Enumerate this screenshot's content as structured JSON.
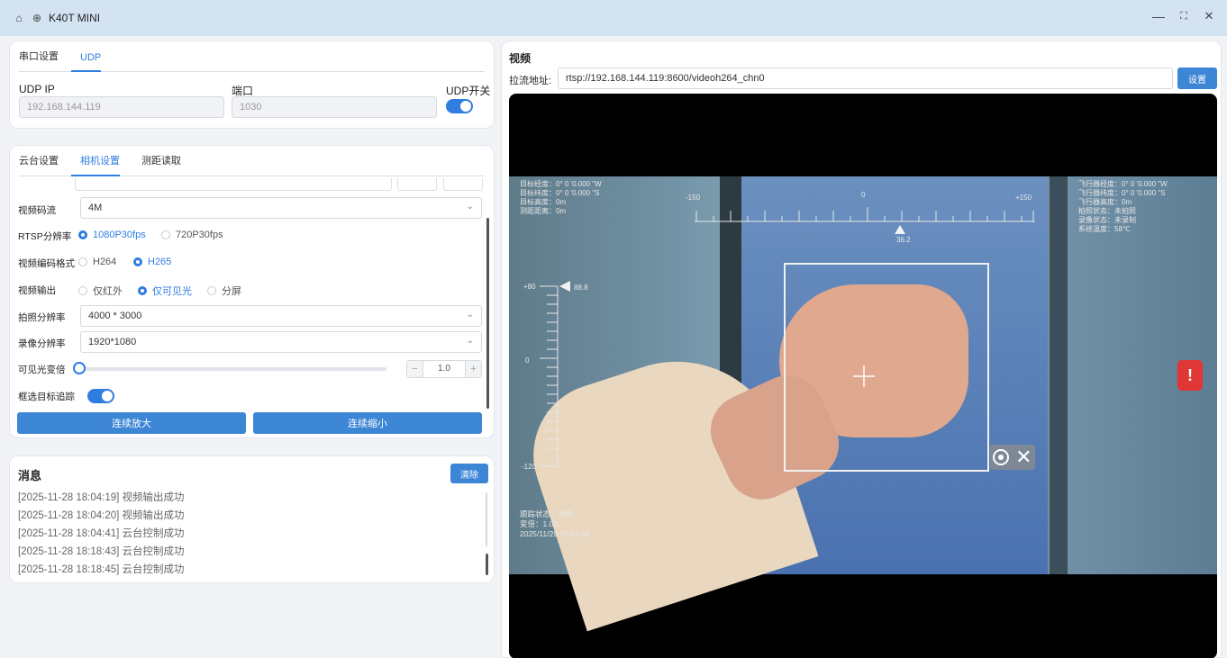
{
  "window": {
    "title": "K40T MINI",
    "controls": {
      "minimize": "—",
      "maximize": "⛶",
      "close": "✕"
    }
  },
  "udp_panel": {
    "tabs": [
      "串口设置",
      "UDP"
    ],
    "active_tab": "UDP",
    "ip_label": "UDP IP",
    "ip_value": "192.168.144.119",
    "port_label": "端口",
    "port_value": "1030",
    "switch_label": "UDP开关",
    "switch_on": true
  },
  "camera_panel": {
    "tabs": [
      "云台设置",
      "相机设置",
      "测距读取"
    ],
    "active_tab": "相机设置",
    "bitrate": {
      "label": "视频码流",
      "value": "4M"
    },
    "rtsp_resolution": {
      "label": "RTSP分辨率",
      "options": [
        "1080P30fps",
        "720P30fps"
      ],
      "selected": "1080P30fps"
    },
    "encoding": {
      "label": "视频编码格式",
      "options": [
        "H264",
        "H265"
      ],
      "selected": "H265"
    },
    "output": {
      "label": "视频输出",
      "options": [
        "仅红外",
        "仅可见光",
        "分屏"
      ],
      "selected": "仅可见光"
    },
    "photo_resolution": {
      "label": "拍照分辨率",
      "value": "4000 * 3000"
    },
    "record_resolution": {
      "label": "录像分辨率",
      "value": "1920*1080"
    },
    "zoom": {
      "label": "可见光变倍",
      "value": "1.0",
      "minus": "−",
      "plus": "+",
      "level": 0
    },
    "tracking": {
      "label": "框选目标追踪",
      "on": true
    },
    "zoom_in_button": "连续放大",
    "zoom_out_button": "连续缩小"
  },
  "messages": {
    "title": "消息",
    "clear_button": "清除",
    "lines": [
      "[2025-11-28 18:04:19] 视频输出成功",
      "[2025-11-28 18:04:20] 视频输出成功",
      "[2025-11-28 18:04:41] 云台控制成功",
      "[2025-11-28 18:18:43] 云台控制成功",
      "[2025-11-28 18:18:45] 云台控制成功"
    ]
  },
  "video": {
    "title": "视频",
    "url_label": "拉流地址:",
    "url_value": "rtsp://192.168.144.119:8600/videoh264_chn0",
    "set_button": "设置",
    "hud": {
      "top_left": "目标经度：0° 0 '0.000 \"W\n目标纬度：0° 0 '0.000 \"S\n目标高度：0m\n测距距离：0m",
      "top_right": "飞行器经度：0° 0 '0.000 \"W\n飞行器纬度：0° 0 '0.000 \"S\n飞行器高度：0m\n拍照状态：未拍照\n录像状态：未录制\n系统温度：58℃",
      "bottom_left": "跟踪状态：待命\n变倍：1.0X\n2025/11/29 02:21:39",
      "yaw_min": "-150",
      "yaw_mid": "0",
      "yaw_max": "+150",
      "yaw_value": "36.2",
      "pitch_max": "+80",
      "pitch_mid": "0",
      "pitch_min": "-120",
      "pitch_value": "88.8"
    }
  }
}
